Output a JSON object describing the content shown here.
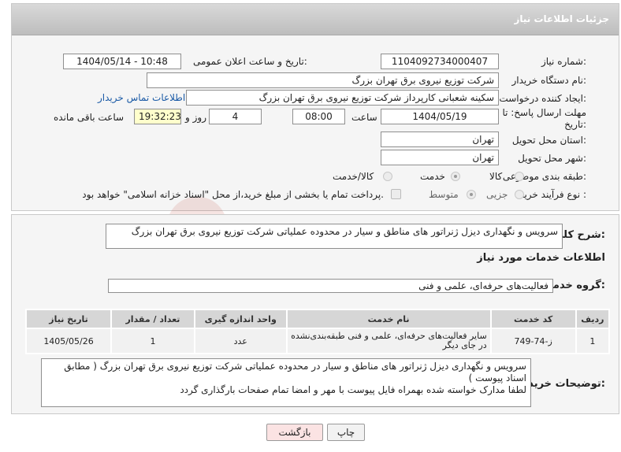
{
  "header": {
    "title": "جزئیات اطلاعات نیاز"
  },
  "form": {
    "need_number": {
      "label": "شماره نیاز:",
      "value": "1104092734000407"
    },
    "announce_datetime": {
      "label": "تاریخ و ساعت اعلان عمومی:",
      "value": "1404/05/14 - 10:48"
    },
    "buyer_org": {
      "label": "نام دستگاه خریدار:",
      "value": "شرکت توزیع نیروی برق تهران بزرگ"
    },
    "requester": {
      "label": "ایجاد کننده درخواست:",
      "value": "سکینه شعبانی کارپرداز شرکت توزیع نیروی برق تهران بزرگ"
    },
    "buyer_contact_link": "اطلاعات تماس خریدار",
    "deadline": {
      "label_line1": "مهلت ارسال پاسخ: تا",
      "label_line2": "تاریخ:",
      "date": "1404/05/19",
      "time_label": "ساعت",
      "time": "08:00",
      "days": "4",
      "days_label": "روز و",
      "remaining_time": "19:32:23",
      "remaining_label": "ساعت باقی مانده"
    },
    "province": {
      "label": "استان محل تحویل:",
      "value": "تهران"
    },
    "city": {
      "label": "شهر محل تحویل:",
      "value": "تهران"
    },
    "category": {
      "label": "طبقه بندی موضوعی:",
      "options": [
        "کالا",
        "خدمت",
        "کالا/خدمت"
      ],
      "selected": "خدمت"
    },
    "purchase_type": {
      "label": "نوع فرآیند خرید :",
      "options": [
        "جزیی",
        "متوسط"
      ],
      "selected": "متوسط",
      "treasury_note": "پرداخت تمام یا بخشی از مبلغ خرید،از محل \"اسناد خزانه اسلامی\" خواهد بود."
    }
  },
  "details": {
    "description_label": "شرح کلی نیاز:",
    "description": "سرویس و نگهداری دیزل ژنراتور های مناطق و سیار در محدوده عملیاتی شرکت توزیع نیروی برق تهران بزرگ",
    "services_title": "اطلاعات خدمات مورد نیاز",
    "service_group_label": "گروه خدمت:",
    "service_group": "فعالیت‌های حرفه‌ای، علمی و فنی",
    "table": {
      "headers": [
        "ردیف",
        "کد خدمت",
        "نام خدمت",
        "واحد اندازه گیری",
        "تعداد / مقدار",
        "تاریخ نیاز"
      ],
      "rows": [
        [
          "1",
          "ز-74-749",
          "سایر فعالیت‌های حرفه‌ای، علمی و فنی طبقه‌بندی‌نشده در جای دیگر",
          "عدد",
          "1",
          "1405/05/26"
        ]
      ]
    },
    "buyer_notes_label": "توضیحات خریدار:",
    "buyer_notes_line1": "سرویس و نگهداری دیزل ژنراتور های مناطق و سیار در محدوده عملیاتی شرکت توزیع نیروی برق تهران بزرگ ( مطابق اسناد پیوست )",
    "buyer_notes_line2": "لطفا مدارک خواسته شده بهمراه فایل پیوست با مهر و امضا تمام صفحات بارگذاری گردد"
  },
  "actions": {
    "print": "چاپ",
    "back": "بازگشت"
  },
  "watermark": {
    "text": "AriaTender.neT",
    "color": "#c0392b"
  },
  "colors": {
    "link": "#1a5aa6",
    "remaining_bg": "#ffffcc",
    "back_bg": "#fbe3e3"
  }
}
